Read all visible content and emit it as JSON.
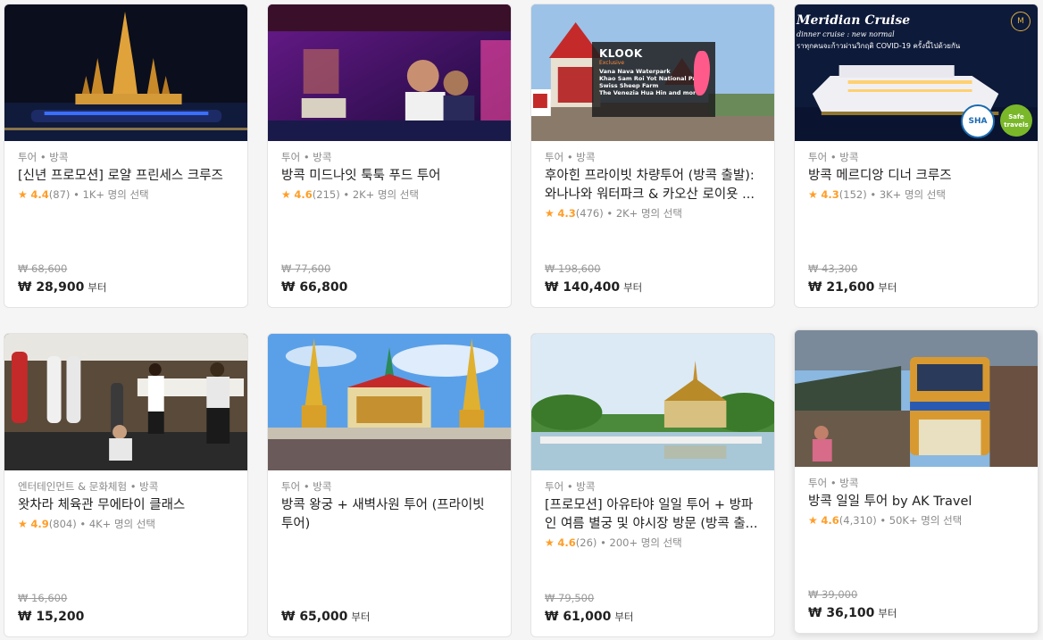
{
  "cards": [
    {
      "category": "투어 • 방콕",
      "title": "[신년 프로모션] 로얄 프린세스 크루즈",
      "rating": "4.4",
      "reviews": "(87)",
      "booked": "• 1K+ 명의 선택",
      "original_price": "₩ 68,600",
      "price": "₩ 28,900",
      "unit": "부터"
    },
    {
      "category": "투어 • 방콕",
      "title": "방콕 미드나잇 툭툭 푸드 투어",
      "rating": "4.6",
      "reviews": "(215)",
      "booked": "• 2K+ 명의 선택",
      "original_price": "₩ 77,600",
      "price": "₩ 66,800",
      "unit": ""
    },
    {
      "category": "투어 • 방콕",
      "title": "후아힌 프라이빗 차량투어 (방콕 출발): 와나나와 워터파크 & 카오산 로이욧 ...",
      "rating": "4.3",
      "reviews": "(476)",
      "booked": "• 2K+ 명의 선택",
      "original_price": "₩ 198,600",
      "price": "₩ 140,400",
      "unit": "부터"
    },
    {
      "category": "투어 • 방콕",
      "title": "방콕 메르디앙 디너 크루즈",
      "rating": "4.3",
      "reviews": "(152)",
      "booked": "• 3K+ 명의 선택",
      "original_price": "₩ 43,300",
      "price": "₩ 21,600",
      "unit": "부터"
    },
    {
      "category": "엔터테인먼트 & 문화체험 • 방콕",
      "title": "왓차라 체육관 무에타이 클래스",
      "rating": "4.9",
      "reviews": "(804)",
      "booked": "• 4K+ 명의 선택",
      "original_price": "₩ 16,600",
      "price": "₩ 15,200",
      "unit": ""
    },
    {
      "category": "투어 • 방콕",
      "title": "방콕 왕궁 + 새벽사원  투어 (프라이빗 투어)",
      "rating": "",
      "reviews": "",
      "booked": "",
      "original_price": "",
      "price": "₩ 65,000",
      "unit": "부터"
    },
    {
      "category": "투어 • 방콕",
      "title": "[프로모션] 아유타야 일일 투어 + 방파인 여름 별궁 및 야시장 방문 (방콕 출...",
      "rating": "4.6",
      "reviews": "(26)",
      "booked": "• 200+ 명의 선택",
      "original_price": "₩ 79,500",
      "price": "₩ 61,000",
      "unit": "부터"
    },
    {
      "category": "투어 • 방콕",
      "title": "방콕 일일 투어 by AK Travel",
      "rating": "4.6",
      "reviews": "(4,310)",
      "booked": "• 50K+ 명의 선택",
      "original_price": "₩ 39,000",
      "price": "₩ 36,100",
      "unit": "부터"
    }
  ],
  "overlays": {
    "klook_logo": "KLOOK",
    "klook_sub": "Exclusive",
    "klook_lines": [
      "Vana Nava Waterpark",
      "Khao Sam Roi Yot National Park",
      "Swiss Sheep Farm",
      "The Venezia Hua Hin and more!"
    ],
    "meridian_title": "Meridian Cruise",
    "meridian_sub": "dinner cruise : new normal",
    "meridian_thai": "ราทุกคนจะก้าวผ่านวิกฤติ COVID-19 ครั้งนี้ไปด้วยกัน",
    "sha_badge": "SHA",
    "safe_badge": "Safe travels"
  },
  "colors": {
    "star": "#ff9d26",
    "border": "#e3e3e3",
    "bg": "#f5f5f5"
  }
}
